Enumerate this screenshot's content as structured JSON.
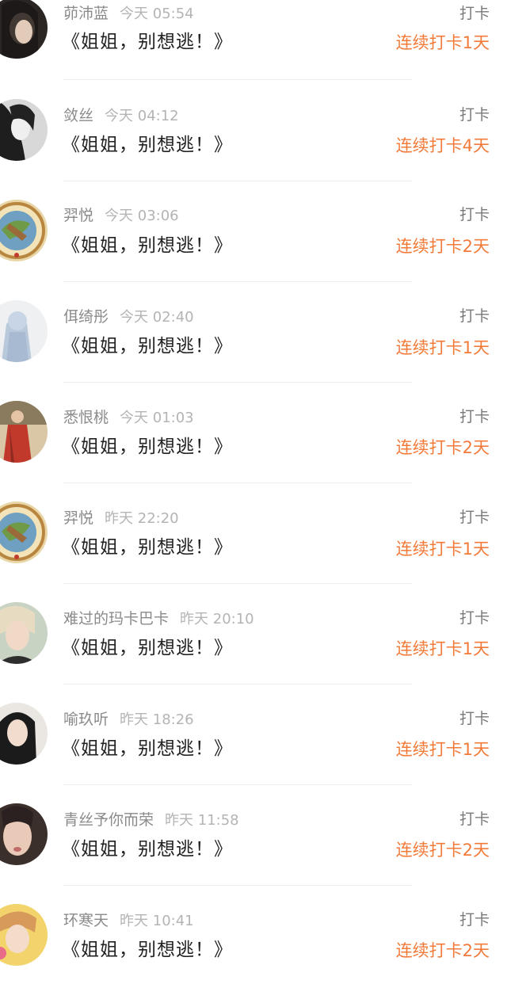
{
  "colors": {
    "streak": "#f27b3a",
    "username": "#8a8a8a",
    "timestamp": "#b4b4b4",
    "title": "#222222",
    "action": "#7a7a7a"
  },
  "entries": [
    {
      "username": "茆沛蓝",
      "time": "今天 05:54",
      "title": "《姐姐，别想逃！》",
      "action": "打卡",
      "streak": "连续打卡1天",
      "avatar": "dark-portrait"
    },
    {
      "username": "敛丝",
      "time": "今天 04:12",
      "title": "《姐姐，别想逃！》",
      "action": "打卡",
      "streak": "连续打卡4天",
      "avatar": "bw-portrait"
    },
    {
      "username": "羿悦",
      "time": "今天 03:06",
      "title": "《姐姐，别想逃！》",
      "action": "打卡",
      "streak": "连续打卡2天",
      "avatar": "emblem"
    },
    {
      "username": "佴绮彤",
      "time": "今天 02:40",
      "title": "《姐姐，别想逃！》",
      "action": "打卡",
      "streak": "连续打卡1天",
      "avatar": "blue-figure"
    },
    {
      "username": "悉恨桃",
      "time": "今天 01:03",
      "title": "《姐姐，别想逃！》",
      "action": "打卡",
      "streak": "连续打卡2天",
      "avatar": "red-figure"
    },
    {
      "username": "羿悦",
      "time": "昨天 22:20",
      "title": "《姐姐，别想逃！》",
      "action": "打卡",
      "streak": "连续打卡1天",
      "avatar": "emblem"
    },
    {
      "username": "难过的玛卡巴卡",
      "time": "昨天 20:10",
      "title": "《姐姐，别想逃！》",
      "action": "打卡",
      "streak": "连续打卡1天",
      "avatar": "light-portrait"
    },
    {
      "username": "喻玖听",
      "time": "昨天 18:26",
      "title": "《姐姐，别想逃！》",
      "action": "打卡",
      "streak": "连续打卡1天",
      "avatar": "dark-hair-portrait"
    },
    {
      "username": "青丝予你而荣",
      "time": "昨天 11:58",
      "title": "《姐姐，别想逃！》",
      "action": "打卡",
      "streak": "连续打卡2天",
      "avatar": "face-portrait"
    },
    {
      "username": "环寒天",
      "time": "昨天 10:41",
      "title": "《姐姐，别想逃！》",
      "action": "打卡",
      "streak": "连续打卡2天",
      "avatar": "yellow-portrait"
    }
  ]
}
